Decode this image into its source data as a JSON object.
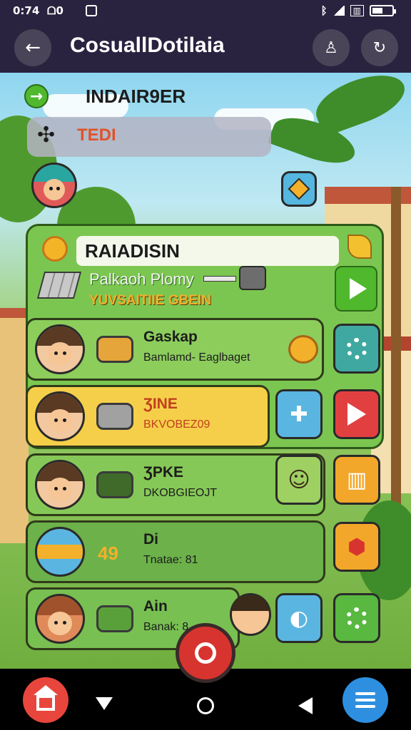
{
  "status_bar": {
    "time": "0:74",
    "extra": "ᗝ0"
  },
  "app_bar": {
    "title": "CosuallDotilaia"
  },
  "scene": {
    "title": "INDAIR9ER",
    "search_value": "TEDI"
  },
  "card": {
    "header": "RAIADISIN",
    "promo_title": "Palkaoh Plomy",
    "promo_subtitle": "YUVSAITIIE GBEIN"
  },
  "rows": [
    {
      "name": "Gaskap",
      "sub": "Bamlamd- Eaglbaget"
    },
    {
      "name": "ƷINE",
      "sub": "BKVOBEZ09"
    },
    {
      "name": "ƷPKE",
      "sub": "DKOBGIEOJT"
    },
    {
      "name": "Di",
      "sub": "Tnatae: 81"
    },
    {
      "name": "Ain",
      "sub": "Banak: 8"
    }
  ],
  "item_labels": {
    "row4_number": "49"
  },
  "colors": {
    "accent_green": "#4fb82d",
    "accent_red": "#e24040",
    "accent_orange": "#f3a72a",
    "accent_blue": "#2e8fe0"
  },
  "icons": {
    "back": "arrow-left-icon",
    "profile": "person-icon",
    "chat": "chat-refresh-icon",
    "home": "house-icon",
    "menu": "list-icon"
  }
}
